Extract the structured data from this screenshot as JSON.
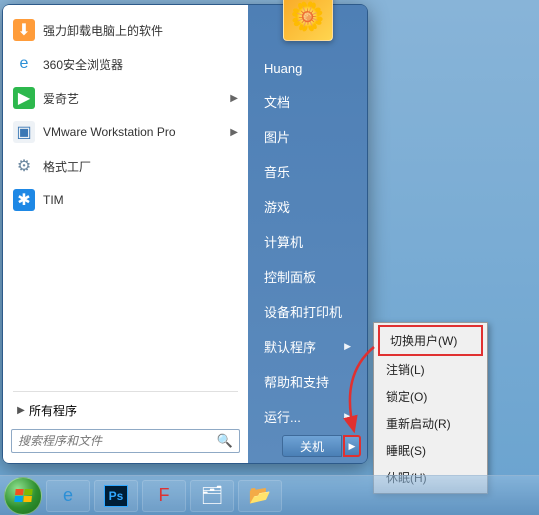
{
  "user": {
    "name": "Huang"
  },
  "apps": [
    {
      "label": "强力卸载电脑上的软件",
      "icon": {
        "bg": "#ff9c3a",
        "sym": "⬇"
      }
    },
    {
      "label": "360安全浏览器",
      "icon": {
        "bg": "transparent",
        "sym": "e",
        "color": "#2b8fd6"
      }
    },
    {
      "label": "爱奇艺",
      "icon": {
        "bg": "#2db84d",
        "sym": "▶",
        "color": "#fff"
      },
      "has_sub": true
    },
    {
      "label": "VMware Workstation Pro",
      "icon": {
        "bg": "#eef2f6",
        "sym": "▣",
        "color": "#3b78b5"
      },
      "has_sub": true
    },
    {
      "label": "格式工厂",
      "icon": {
        "bg": "transparent",
        "sym": "⚙",
        "color": "#6b879f"
      }
    },
    {
      "label": "TIM",
      "icon": {
        "bg": "#1e88e5",
        "sym": "✱",
        "color": "#fff"
      }
    }
  ],
  "all_programs_label": "所有程序",
  "search": {
    "placeholder": "搜索程序和文件"
  },
  "right_links": [
    {
      "label": "Huang"
    },
    {
      "label": "文档"
    },
    {
      "label": "图片"
    },
    {
      "label": "音乐"
    },
    {
      "label": "游戏"
    },
    {
      "label": "计算机"
    },
    {
      "label": "控制面板"
    },
    {
      "label": "设备和打印机"
    },
    {
      "label": "默认程序",
      "has_sub": true
    },
    {
      "label": "帮助和支持"
    },
    {
      "label": "运行...",
      "has_sub": true
    }
  ],
  "shutdown": {
    "label": "关机"
  },
  "power_menu": [
    {
      "label": "切换用户(W)",
      "highlighted": true
    },
    {
      "label": "注销(L)"
    },
    {
      "label": "锁定(O)"
    },
    {
      "label": "重新启动(R)"
    },
    {
      "label": "睡眠(S)"
    },
    {
      "label": "休眠(H)"
    }
  ],
  "taskbar_items": [
    {
      "name": "ie",
      "sym": "e",
      "color": "#2b8fd6"
    },
    {
      "name": "photoshop",
      "sym": "Ps"
    },
    {
      "name": "flash",
      "sym": "F",
      "color": "#d33"
    },
    {
      "name": "explorer",
      "sym": "🗂"
    },
    {
      "name": "folder-open",
      "sym": "📂"
    }
  ]
}
